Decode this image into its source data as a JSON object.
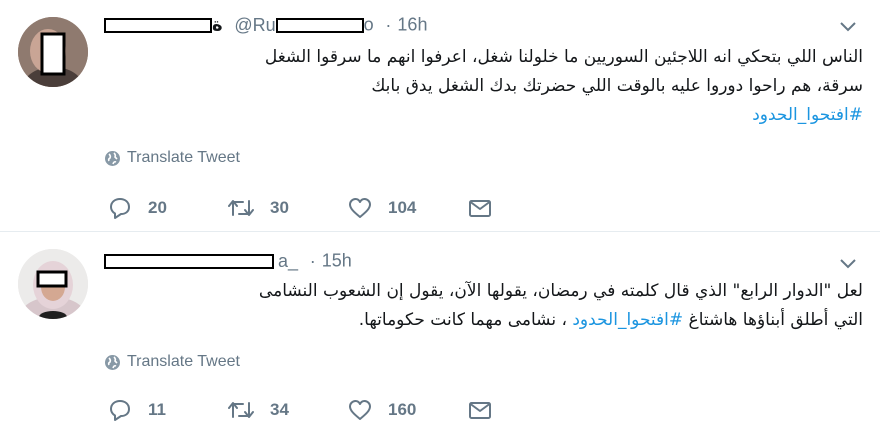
{
  "tweets": [
    {
      "name_fragment": "ة",
      "handle": "@Ru",
      "handle_tail": "o",
      "dot": "·",
      "time": "16h",
      "text_lines": [
        "الناس اللي بتحكي انه اللاجئين السوريين ما خلولنا شغل، اعرفوا انهم ما سرقوا الشغل",
        "سرقة، هم راحوا دوروا عليه بالوقت اللي حضرتك بدك الشغل يدق بابك"
      ],
      "hashtag": "#افتحوا_الحدود",
      "translate_label": "Translate Tweet",
      "replies": "20",
      "retweets": "30",
      "likes": "104"
    },
    {
      "handle": "a_",
      "dot": "·",
      "time": "15h",
      "line1": "لعل \"الدوار الرابع\" الذي قال كلمته في رمضان، يقولها الآن، يقول إن الشعوب النشامى",
      "line2_pre": "التي أطلق أبناؤها هاشتاغ ",
      "hashtag": "#افتحوا_الحدود",
      "line2_post": " ، نشامى مهما كانت حكوماتها.",
      "translate_label": "Translate Tweet",
      "replies": "11",
      "retweets": "34",
      "likes": "160"
    }
  ],
  "colors": {
    "text": "#14171a",
    "secondary": "#657786",
    "link": "#1b95e0",
    "divider": "#e6ecf0"
  },
  "icons": [
    "globe-icon",
    "reply-icon",
    "retweet-icon",
    "like-icon",
    "direct-message-icon",
    "chevron-down-icon"
  ]
}
